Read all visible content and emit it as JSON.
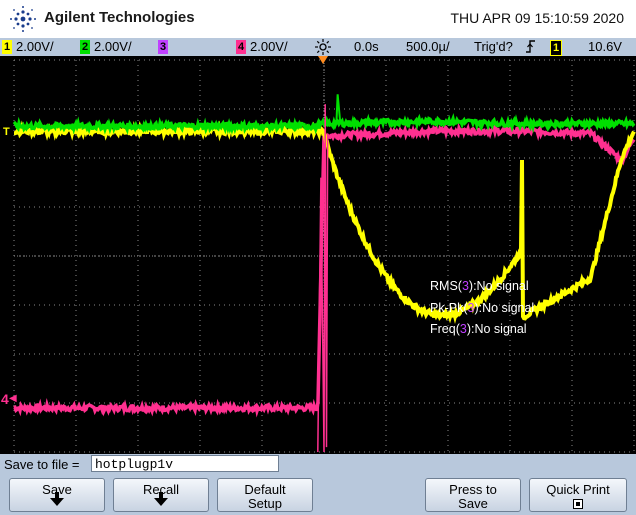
{
  "header": {
    "brand": "Agilent Technologies",
    "datetime": "THU APR 09 15:10:59 2020"
  },
  "status_bar": {
    "ch1_num": "1",
    "ch1_scale": "2.00V/",
    "ch2_num": "2",
    "ch2_scale": "2.00V/",
    "ch3_num": "3",
    "ch4_num": "4",
    "ch4_scale": "2.00V/",
    "time_delay": "0.0s",
    "time_scale": "500.0µ/",
    "trigger_status": "Trig'd?",
    "trigger_channel": "1",
    "trigger_level": "10.6V"
  },
  "measurements": [
    {
      "prefix": "RMS(",
      "channel": "3",
      "suffix": "):No signal"
    },
    {
      "prefix": "Pk-Pk(",
      "channel": "3",
      "suffix": "):No signal"
    },
    {
      "prefix": "Freq(",
      "channel": "3",
      "suffix": "):No signal"
    }
  ],
  "markers": {
    "trigger_marker": "T",
    "ground_ch4": "4"
  },
  "save_bar": {
    "label": "Save to file =",
    "filename": "hotplugp1v"
  },
  "softkeys": {
    "save": "Save",
    "recall": "Recall",
    "default_line1": "Default",
    "default_line2": "Setup",
    "press_line1": "Press to",
    "press_line2": "Save",
    "quick_print": "Quick Print"
  },
  "colors": {
    "ch1": "#ffff00",
    "ch2": "#00e000",
    "ch3": "#c040ff",
    "ch4": "#ff3090",
    "grid": "#8a8a8a",
    "screen_bg": "#000000",
    "chrome": "#b8c8dc"
  },
  "icons": {
    "logo": "agilent-spark-icon",
    "horizontal_position": "sun-icon",
    "trigger_slope": "rising-edge-icon",
    "softkey_down": "down-arrow-icon",
    "quick_print": "printer-square-icon"
  },
  "chart_data": {
    "type": "line",
    "x_range_us": [
      -2500,
      2500
    ],
    "y_range_divisions": [
      -4,
      4
    ],
    "grid": true,
    "series": [
      {
        "channel": "1",
        "x_us": [
          -2500,
          -400,
          -300,
          -50,
          0,
          900,
          1600,
          2150,
          2400,
          2500
        ],
        "y_div": [
          2.55,
          2.55,
          2.55,
          2.55,
          2.55,
          0.1,
          -1.25,
          -0.45,
          2.0,
          2.55
        ]
      },
      {
        "channel": "2",
        "x_us": [
          -2500,
          -400,
          -300,
          -50,
          0,
          900,
          1600,
          2150,
          2400,
          2500
        ],
        "y_div": [
          2.65,
          2.65,
          2.65,
          2.65,
          2.7,
          2.75,
          2.7,
          2.7,
          2.7,
          2.7
        ]
      },
      {
        "channel": "4",
        "x_us": [
          -2500,
          -400,
          -300,
          -50,
          0,
          900,
          1600,
          2150,
          2400,
          2500
        ],
        "y_div": [
          -3.1,
          -3.1,
          -3.1,
          -3.1,
          2.45,
          2.55,
          2.55,
          2.5,
          1.95,
          2.4
        ]
      }
    ]
  }
}
